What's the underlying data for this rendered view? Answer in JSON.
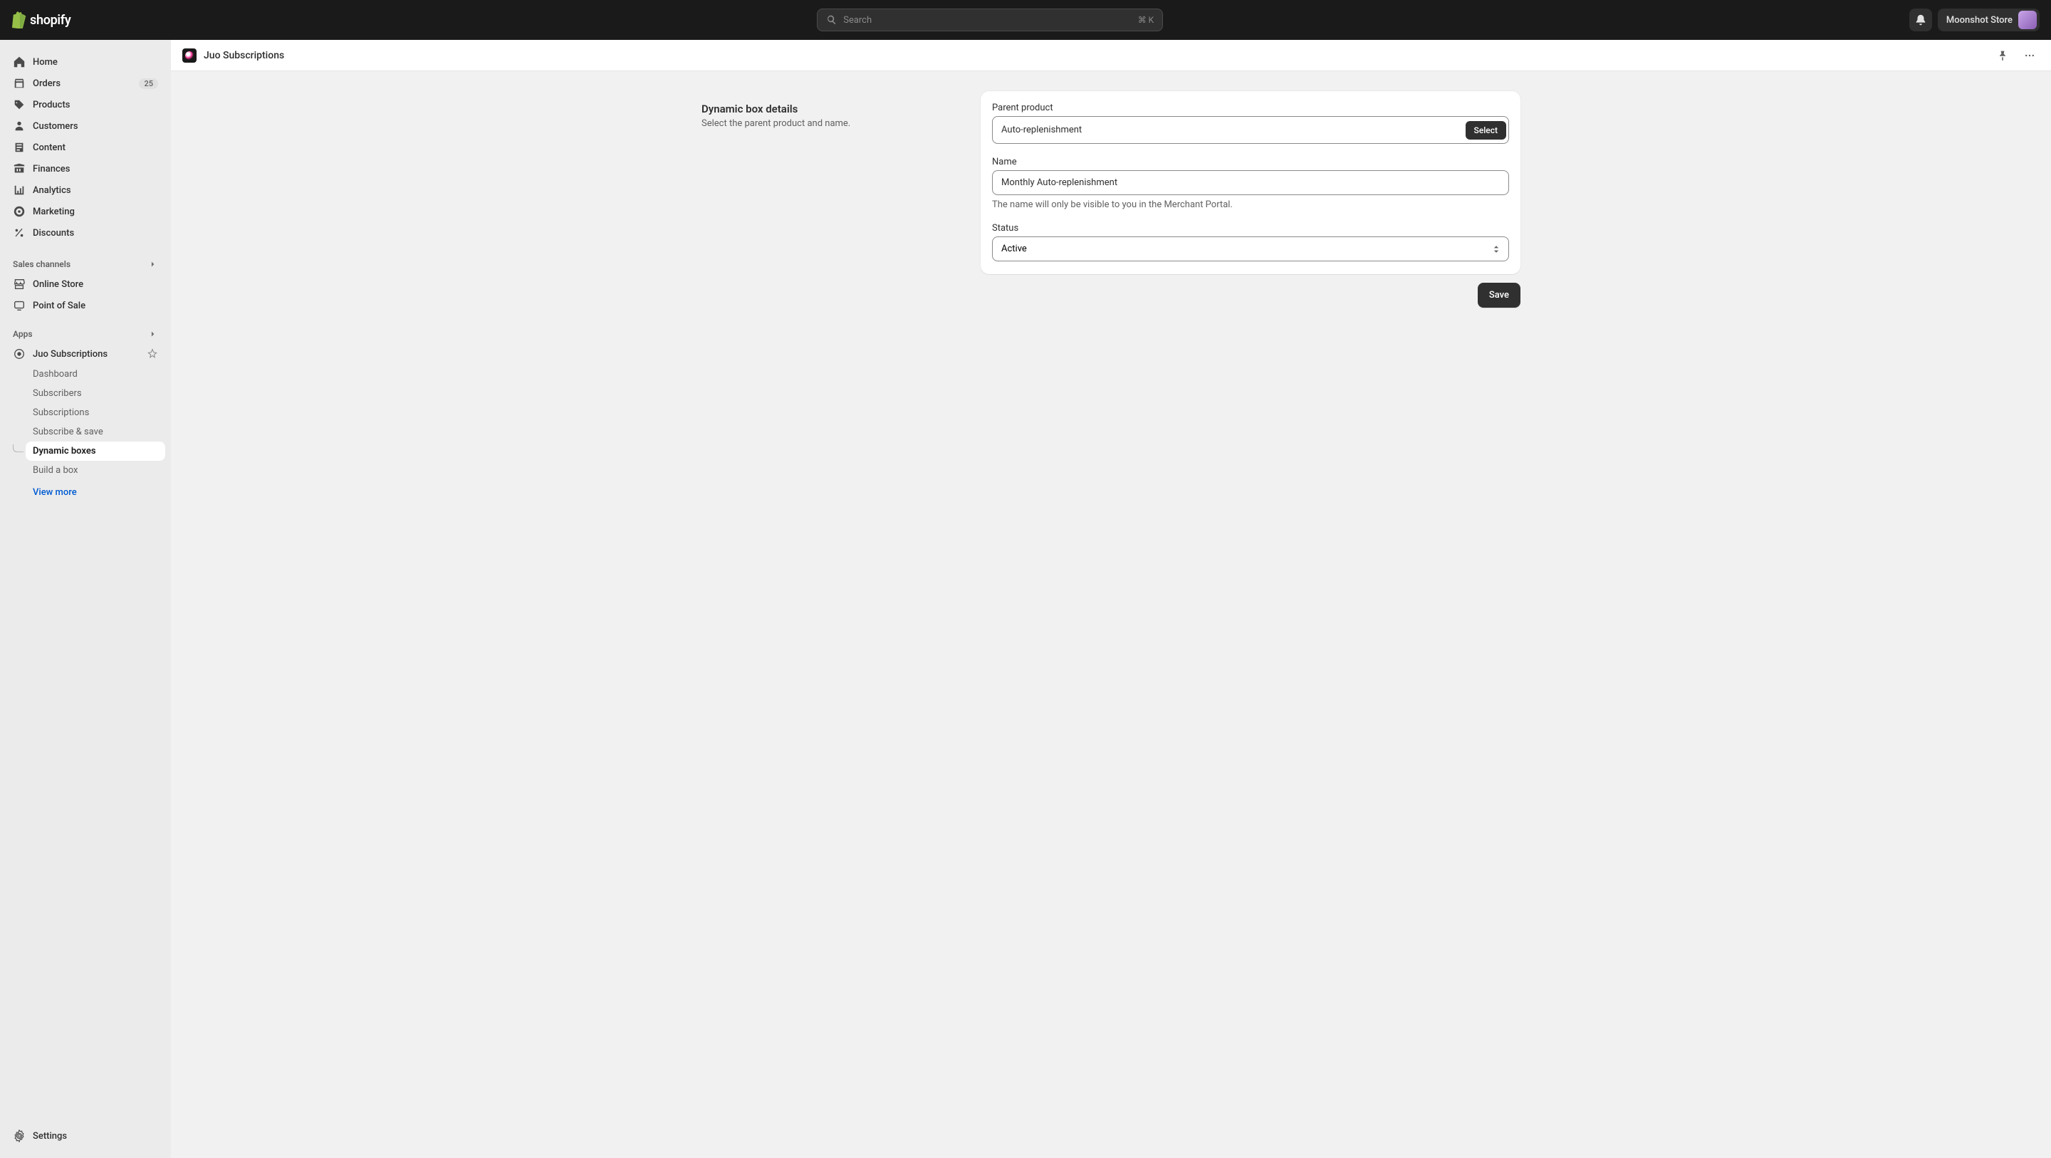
{
  "topbar": {
    "search_placeholder": "Search",
    "search_shortcut": "⌘ K",
    "store_name": "Moonshot Store"
  },
  "sidebar": {
    "nav": [
      {
        "icon": "home",
        "label": "Home"
      },
      {
        "icon": "orders",
        "label": "Orders",
        "badge": "25"
      },
      {
        "icon": "products",
        "label": "Products"
      },
      {
        "icon": "customers",
        "label": "Customers"
      },
      {
        "icon": "content",
        "label": "Content"
      },
      {
        "icon": "finances",
        "label": "Finances"
      },
      {
        "icon": "analytics",
        "label": "Analytics"
      },
      {
        "icon": "marketing",
        "label": "Marketing"
      },
      {
        "icon": "discounts",
        "label": "Discounts"
      }
    ],
    "sales_channels_label": "Sales channels",
    "sales_channels": [
      {
        "label": "Online Store"
      },
      {
        "label": "Point of Sale"
      }
    ],
    "apps_label": "Apps",
    "apps": [
      {
        "label": "Juo Subscriptions",
        "pinned": true
      }
    ],
    "app_subnav": [
      {
        "label": "Dashboard"
      },
      {
        "label": "Subscribers"
      },
      {
        "label": "Subscriptions"
      },
      {
        "label": "Subscribe & save"
      },
      {
        "label": "Dynamic boxes",
        "active": true
      },
      {
        "label": "Build a box"
      }
    ],
    "view_more": "View more",
    "settings_label": "Settings"
  },
  "app_header": {
    "title": "Juo Subscriptions"
  },
  "page": {
    "section_title": "Dynamic box details",
    "section_desc": "Select the parent product and name.",
    "parent_product_label": "Parent product",
    "parent_product_value": "Auto-replenishment",
    "select_button": "Select",
    "name_label": "Name",
    "name_value": "Monthly Auto-replenishment",
    "name_help": "The name will only be visible to you in the Merchant Portal.",
    "status_label": "Status",
    "status_value": "Active",
    "save_button": "Save"
  }
}
